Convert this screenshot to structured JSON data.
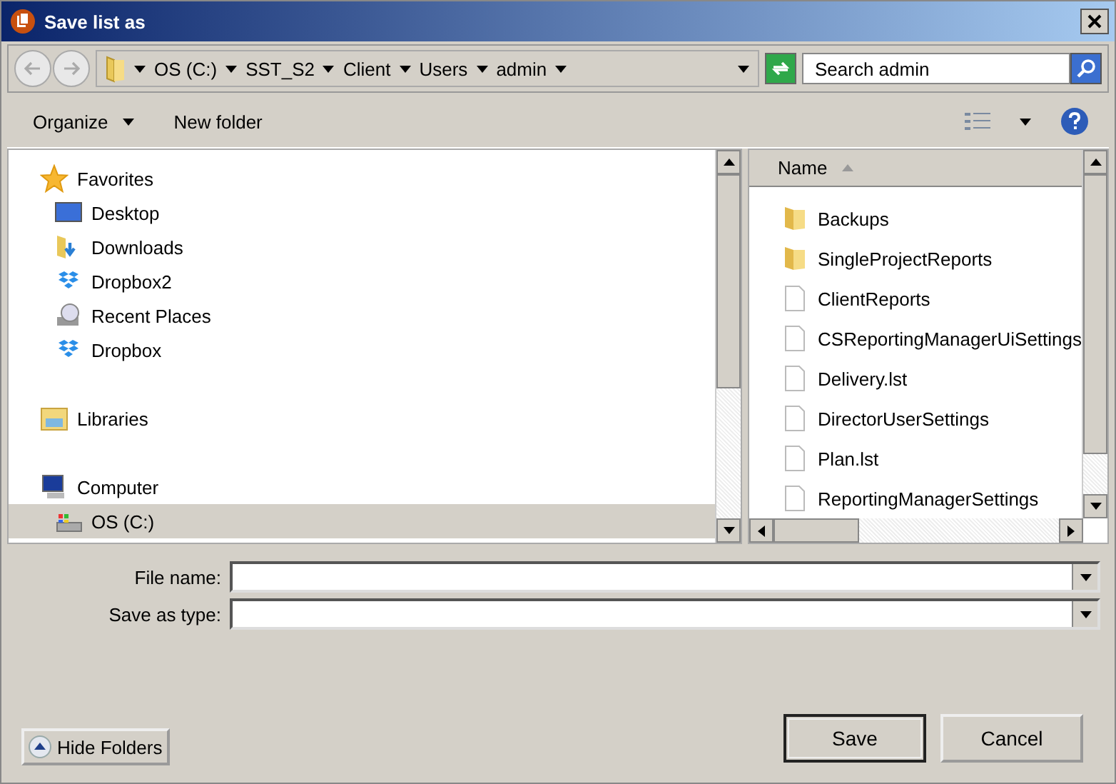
{
  "window": {
    "title": "Save list as"
  },
  "address_bar": {
    "breadcrumbs": [
      "OS (C:)",
      "SST_S2",
      "Client",
      "Users",
      "admin"
    ]
  },
  "search": {
    "placeholder": "Search admin"
  },
  "toolbar": {
    "organize": "Organize",
    "new_folder": "New folder"
  },
  "navigation": [
    {
      "label": "Favorites",
      "selected": false,
      "children": [
        {
          "label": "Desktop",
          "selected": false
        },
        {
          "label": "Downloads",
          "selected": false
        },
        {
          "label": "Dropbox2",
          "selected": false
        },
        {
          "label": "Recent Places",
          "selected": false
        },
        {
          "label": "Dropbox",
          "selected": false
        }
      ]
    },
    {
      "label": "Libraries",
      "selected": false
    },
    {
      "label": "Computer",
      "selected": false,
      "children": [
        {
          "label": "OS (C:)",
          "selected": true
        }
      ]
    }
  ],
  "file_list": {
    "column": "Name",
    "sorted_ascending": true,
    "items": [
      {
        "name": "Backups",
        "kind": "folder"
      },
      {
        "name": "SingleProjectReports",
        "kind": "folder"
      },
      {
        "name": "ClientReports",
        "kind": "file"
      },
      {
        "name": "CSReportingManagerUiSettings",
        "kind": "file"
      },
      {
        "name": "Delivery.lst",
        "kind": "file"
      },
      {
        "name": "DirectorUserSettings",
        "kind": "file"
      },
      {
        "name": "Plan.lst",
        "kind": "file"
      },
      {
        "name": "ReportingManagerSettings",
        "kind": "file"
      }
    ]
  },
  "fields": [
    {
      "label": "File name:"
    },
    {
      "label": "Save as type:"
    }
  ],
  "hide_folders": "Hide Folders",
  "buttons": [
    {
      "label": "Save",
      "default": true
    },
    {
      "label": "Cancel",
      "default": false
    }
  ]
}
